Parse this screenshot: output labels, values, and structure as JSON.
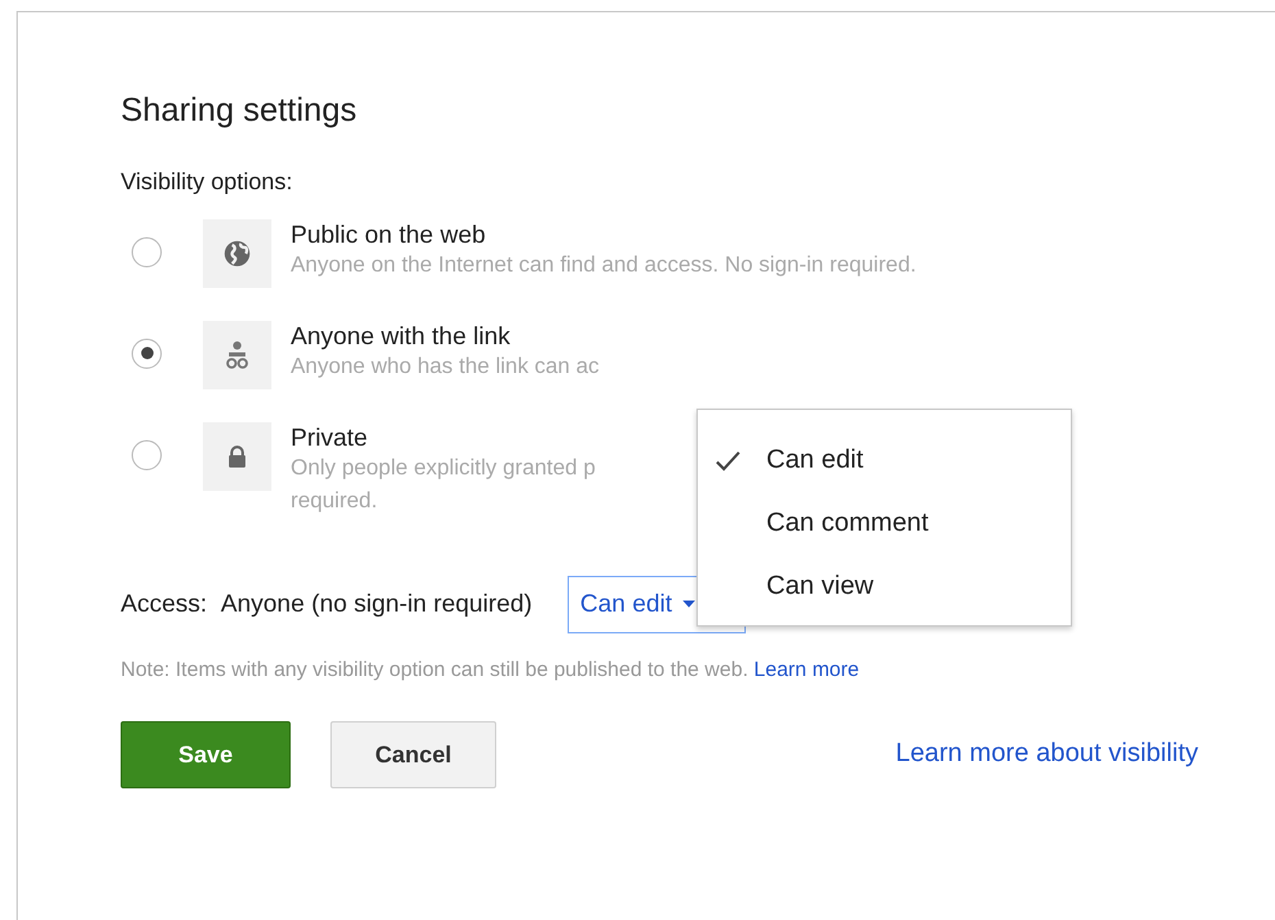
{
  "dialog": {
    "title": "Sharing settings"
  },
  "visibility_label": "Visibility options:",
  "options": [
    {
      "kind": "globe",
      "title": "Public on the web",
      "description": [
        "Anyone on the Internet can find and access. No sign-in required."
      ],
      "selected": false
    },
    {
      "kind": "link",
      "title": "Anyone with the link",
      "description": [
        "Anyone who has the link can ac"
      ],
      "selected": true
    },
    {
      "kind": "lock",
      "title": "Private",
      "description": [
        "Only people explicitly granted p",
        "required."
      ],
      "selected": false
    }
  ],
  "access": {
    "label": "Access:",
    "value": "Anyone (no sign-in required)",
    "dropdown": "Can edit"
  },
  "menu": [
    {
      "label": "Can edit",
      "checked": true
    },
    {
      "label": "Can comment",
      "checked": false
    },
    {
      "label": "Can view",
      "checked": false
    }
  ],
  "note": {
    "text": "Note: Items with any visibility option can still be published to the web.",
    "link": "Learn more"
  },
  "buttons": {
    "save": "Save",
    "cancel": "Cancel"
  },
  "footer_link": "Learn more about visibility"
}
